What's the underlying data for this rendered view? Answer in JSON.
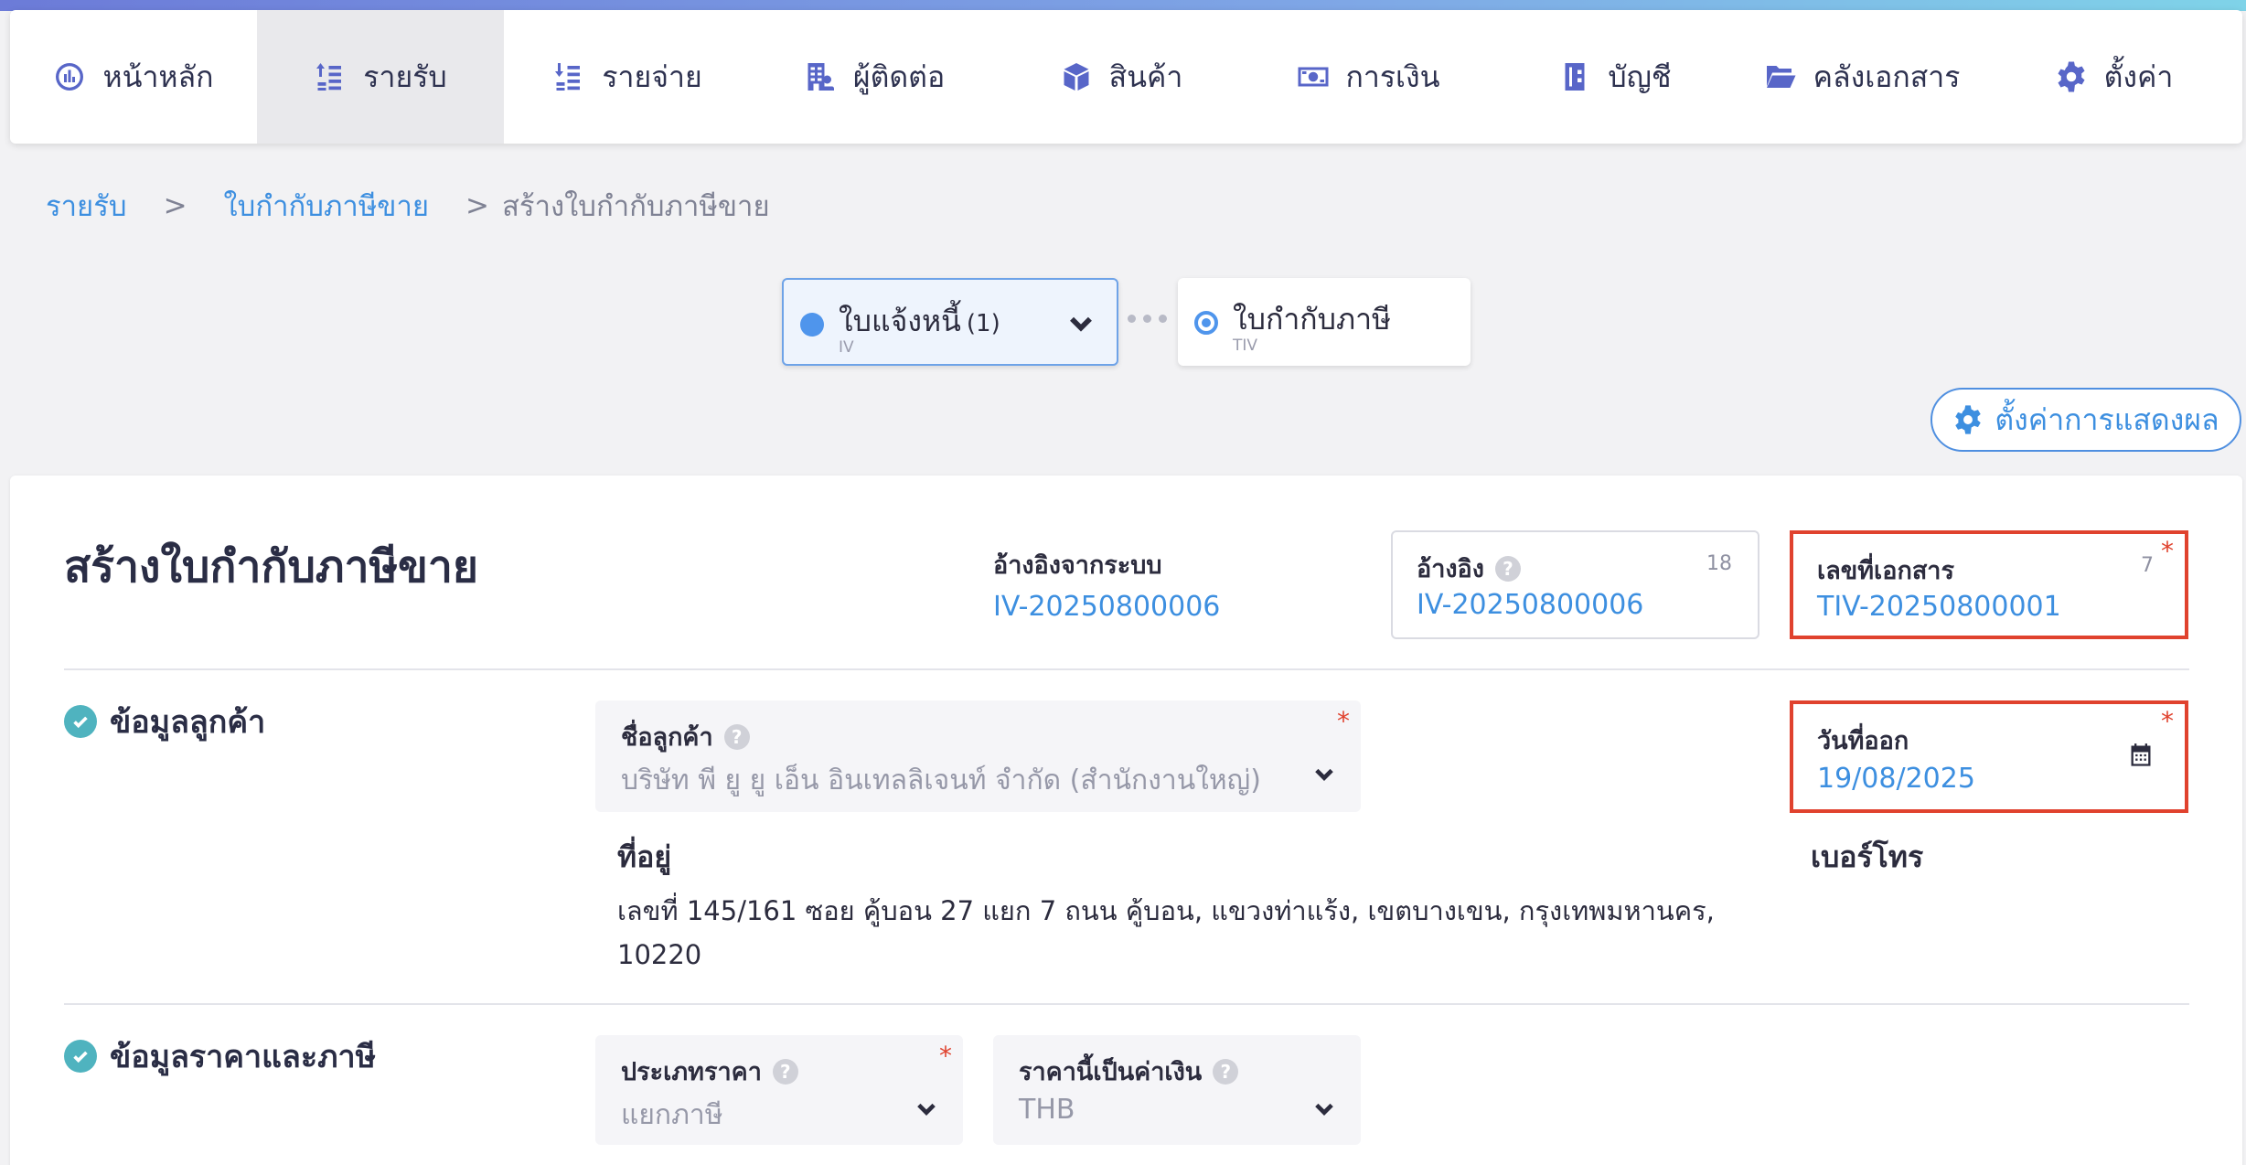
{
  "nav": {
    "items": [
      {
        "label": "หน้าหลัก",
        "icon": "dashboard-icon"
      },
      {
        "label": "รายรับ",
        "icon": "income-icon"
      },
      {
        "label": "รายจ่าย",
        "icon": "expense-icon"
      },
      {
        "label": "ผู้ติดต่อ",
        "icon": "contacts-icon"
      },
      {
        "label": "สินค้า",
        "icon": "product-box-icon"
      },
      {
        "label": "การเงิน",
        "icon": "money-icon"
      },
      {
        "label": "บัญชี",
        "icon": "accounting-book-icon"
      },
      {
        "label": "คลังเอกสาร",
        "icon": "folder-icon"
      },
      {
        "label": "ตั้งค่า",
        "icon": "gear-icon"
      }
    ],
    "active_index": 1
  },
  "breadcrumb": {
    "item1": "รายรับ",
    "item2": "ใบกำกับภาษีขาย",
    "current": "สร้างใบกำกับภาษีขาย",
    "sep": ">"
  },
  "flow": {
    "step1": {
      "title": "ใบแจ้งหนี้",
      "count": "(1)",
      "code": "IV"
    },
    "step2": {
      "title": "ใบกำกับภาษี",
      "code": "TIV"
    }
  },
  "display_settings_label": "ตั้งค่าการแสดงผล",
  "form": {
    "title": "สร้างใบกำกับภาษีขาย",
    "ref_system": {
      "label": "อ้างอิงจากระบบ",
      "value": "IV-20250800006"
    },
    "reference": {
      "label": "อ้างอิง",
      "value": "IV-20250800006",
      "count": "18"
    },
    "doc_number": {
      "label": "เลขที่เอกสาร",
      "value": "TIV-20250800001",
      "count": "7",
      "required": "*"
    },
    "issue_date": {
      "label": "วันที่ออก",
      "value": "19/08/2025",
      "required": "*"
    },
    "customer_section": {
      "title": "ข้อมูลลูกค้า",
      "customer_name": {
        "label": "ชื่อลูกค้า",
        "value": "บริษัท พี ยู ยู เอ็น อินเทลลิเจนท์ จำกัด (สำนักงานใหญ่)",
        "required": "*"
      },
      "address_label": "ที่อยู่",
      "address": "เลขที่ 145/161 ซอย คู้บอน 27 แยก 7 ถนน คู้บอน, แขวงท่าแร้ง, เขตบางเขน, กรุงเทพมหานคร, 10220",
      "phone_label": "เบอร์โทร"
    },
    "price_section": {
      "title": "ข้อมูลราคาและภาษี",
      "price_type": {
        "label": "ประเภทราคา",
        "value": "แยกภาษี",
        "required": "*"
      },
      "currency": {
        "label": "ราคานี้เป็นค่าเงิน",
        "value": "THB"
      }
    },
    "help_glyph": "?"
  }
}
